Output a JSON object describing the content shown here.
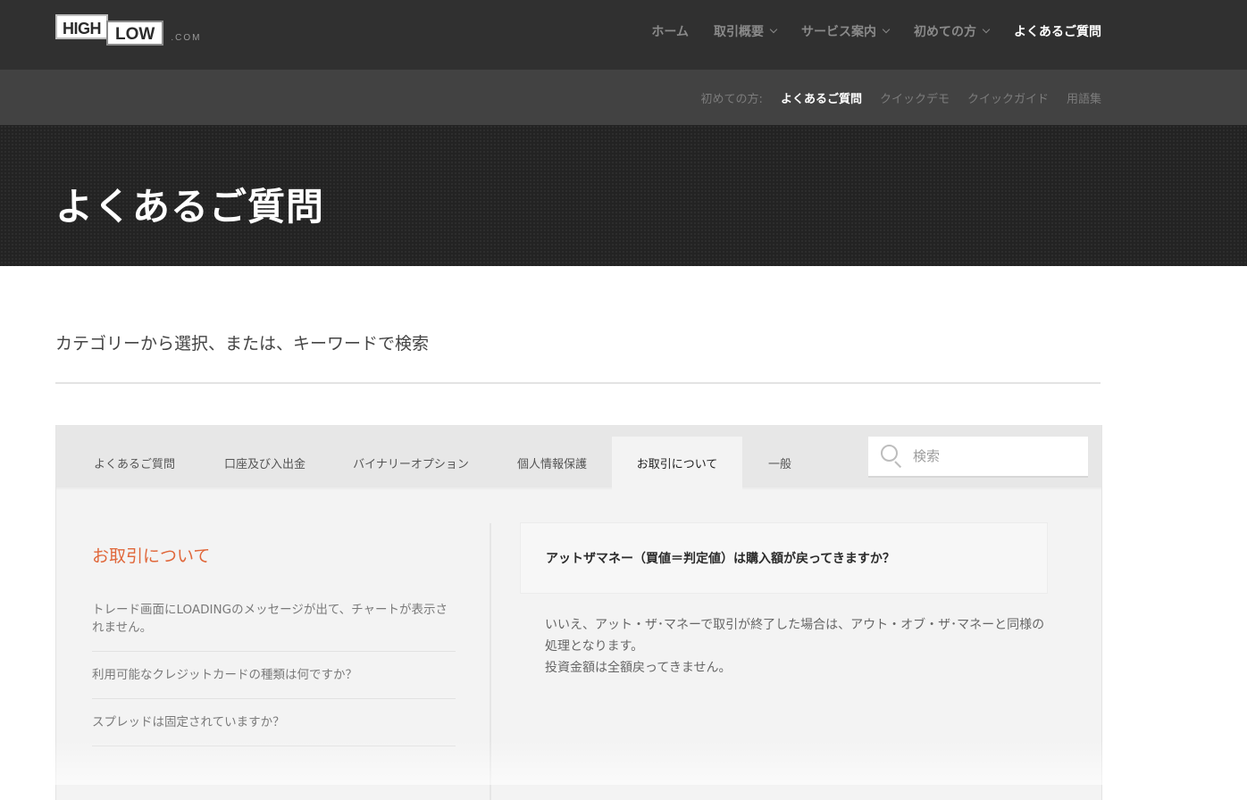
{
  "logo": {
    "high": "HIGH",
    "low": "LOW",
    "com": ".COM"
  },
  "mainnav": {
    "items": [
      {
        "label": "ホーム",
        "has_dropdown": false
      },
      {
        "label": "取引概要",
        "has_dropdown": true
      },
      {
        "label": "サービス案内",
        "has_dropdown": true
      },
      {
        "label": "初めての方",
        "has_dropdown": true
      },
      {
        "label": "よくあるご質問",
        "has_dropdown": false,
        "active": true
      }
    ]
  },
  "subnav": {
    "prefix": "初めての方:",
    "items": [
      {
        "label": "よくあるご質問",
        "active": true
      },
      {
        "label": "クイックデモ"
      },
      {
        "label": "クイックガイド"
      },
      {
        "label": "用語集"
      }
    ]
  },
  "hero": {
    "title": "よくあるご質問"
  },
  "intro": "カテゴリーから選択、または、キーワードで検索",
  "tabs": [
    {
      "label": "よくあるご質問"
    },
    {
      "label": "口座及び入出金"
    },
    {
      "label": "バイナリーオプション"
    },
    {
      "label": "個人情報保護"
    },
    {
      "label": "お取引について",
      "active": true
    },
    {
      "label": "一般"
    }
  ],
  "search": {
    "placeholder": "検索",
    "value": ""
  },
  "category": {
    "title": "お取引について",
    "questions": [
      "トレード画面にLOADINGのメッセージが出て、チャートが表示されません。",
      "利用可能なクレジットカードの種類は何ですか？",
      "スプレッドは固定されていますか？"
    ]
  },
  "selected": {
    "question": "アットザマネー（買値＝判定値）は購入額が戻ってきますか？",
    "answer_line1": "いいえ、アット・ザ･マネーで取引が終了した場合は、アウト・オブ・ザ･マネーと同様の処理となります。",
    "answer_line2": "投資金額は全額戻ってきません。"
  },
  "colors": {
    "accent": "#e0673a",
    "topbar": "#303030",
    "subbar": "#424242",
    "hero": "#232323"
  }
}
